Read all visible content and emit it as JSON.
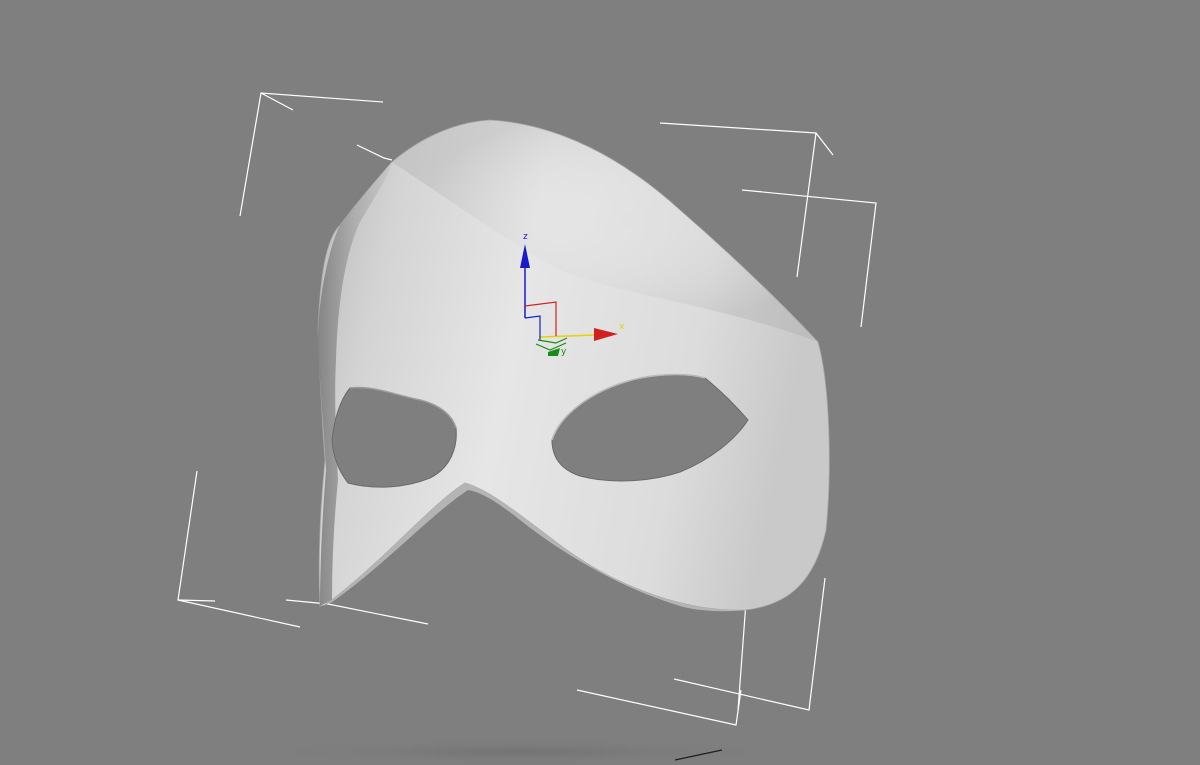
{
  "viewport": {
    "background_color": "#7f7f7f",
    "selection_bracket_color": "#ffffff"
  },
  "object": {
    "type": "mask",
    "surface_color": "#d9d9d9"
  },
  "gizmo": {
    "axes": [
      {
        "label": "z",
        "color": "#1a1acc"
      },
      {
        "label": "x",
        "color": "#d02020"
      },
      {
        "label": "y",
        "color": "#1a8a1a"
      }
    ],
    "active_highlight_color": "#e6d200"
  }
}
